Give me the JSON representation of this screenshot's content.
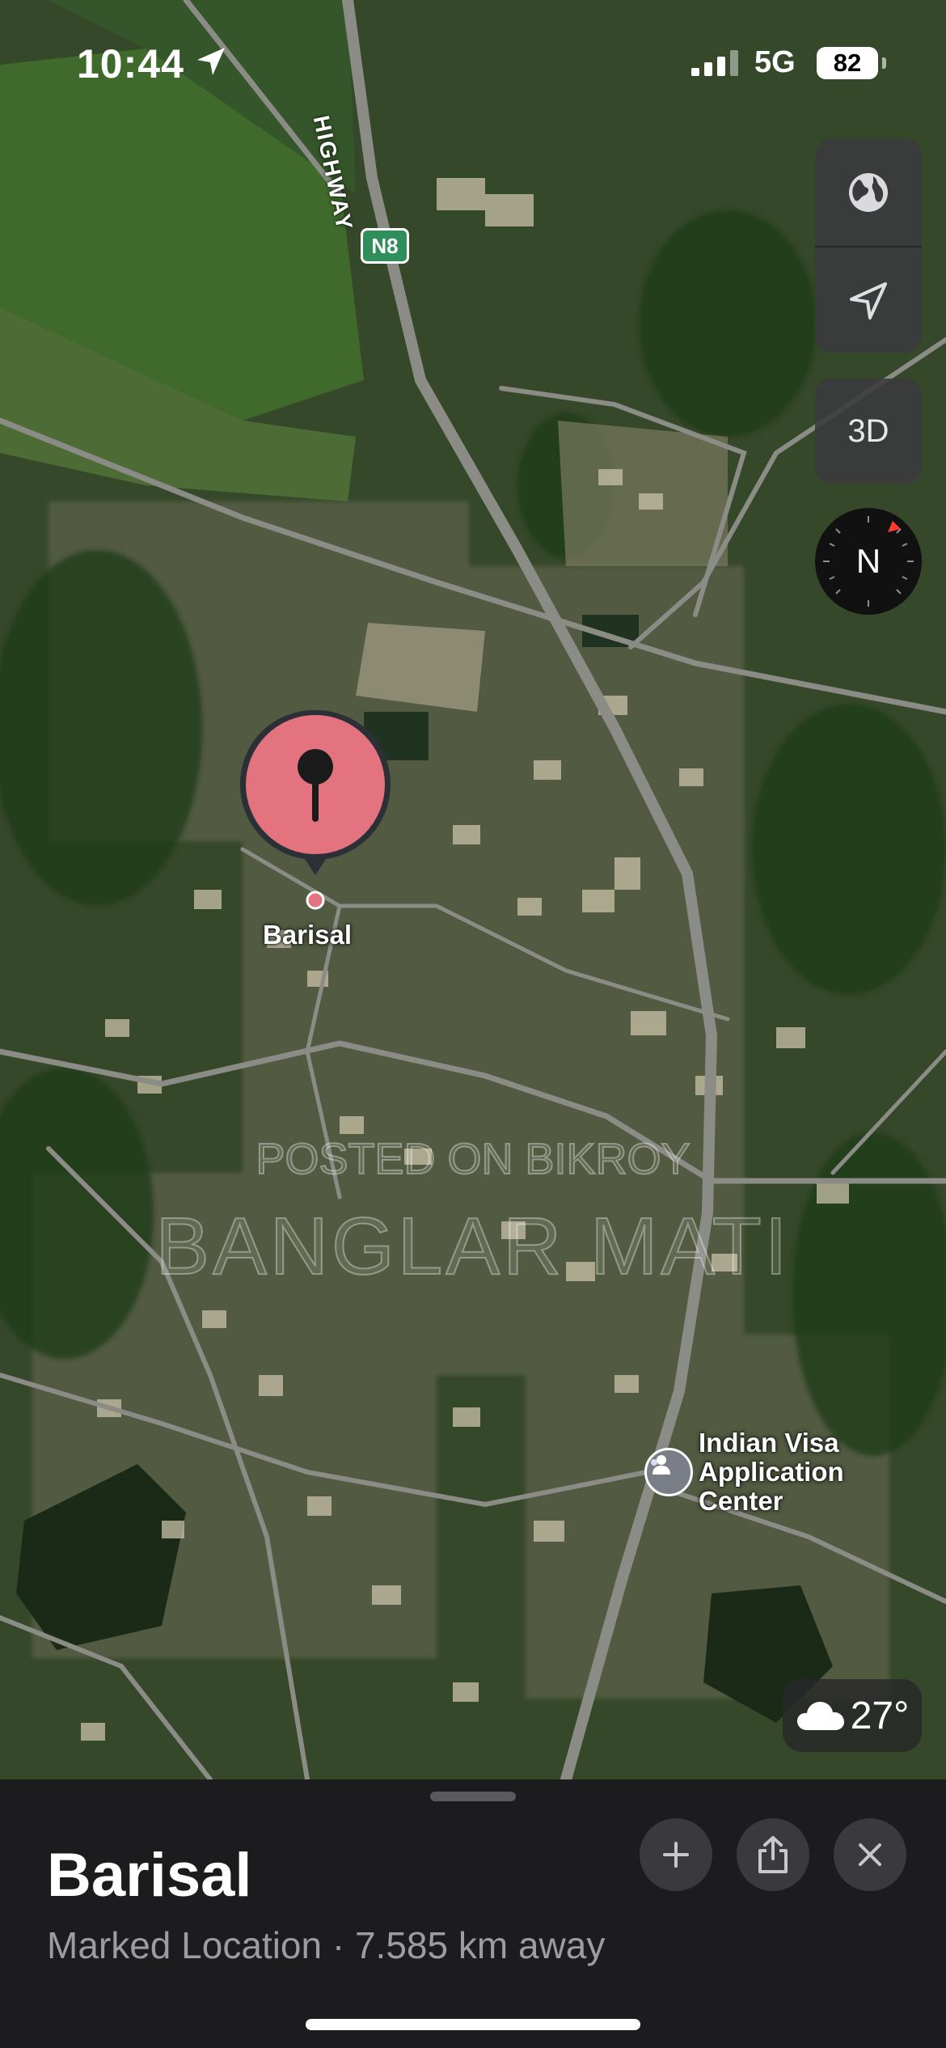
{
  "status_bar": {
    "time": "10:44",
    "network": "5G",
    "battery": "82"
  },
  "map": {
    "highway_name": "HIGHWAY",
    "highway_shield": "N8",
    "pin_label": "Barisal",
    "poi": {
      "icon": "consulate-icon",
      "lines": [
        "Indian Visa",
        "Application",
        "Center"
      ]
    },
    "watermark_line1": "POSTED ON BIKROY",
    "watermark_line2": "BANGLAR MATI",
    "pin_color": "#e3737f"
  },
  "controls": {
    "globe_icon": "globe-icon",
    "location_icon": "location-arrow-icon",
    "three_d_label": "3D",
    "compass_label": "N"
  },
  "weather": {
    "icon": "cloud-icon",
    "temperature": "27°"
  },
  "sheet": {
    "title": "Barisal",
    "subtitle": "Marked Location · 7.585 km away",
    "buttons": [
      "add-icon",
      "share-icon",
      "close-icon"
    ]
  }
}
